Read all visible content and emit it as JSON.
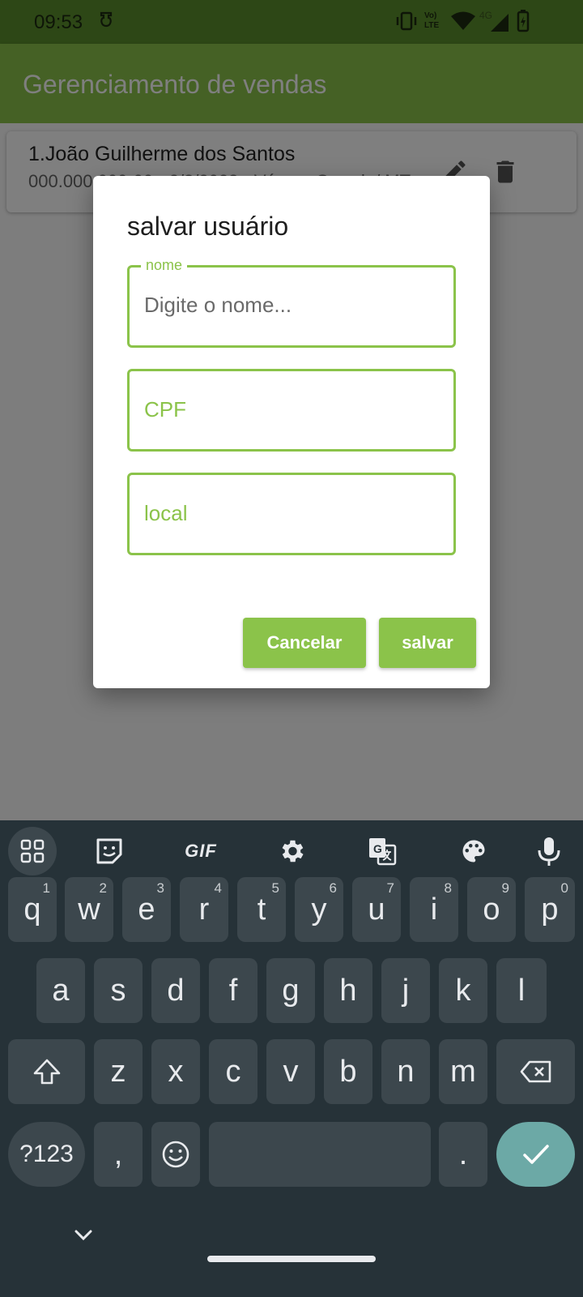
{
  "status_bar": {
    "time": "09:53",
    "network": "4G",
    "lte": "LTE"
  },
  "app_bar": {
    "title": "Gerenciamento de vendas"
  },
  "list": [
    {
      "title": "1.João Guilherme dos Santos",
      "subtitle": "000.000.000-00 - 2/3/2023 - Várzea Grande/ MT"
    }
  ],
  "dialog": {
    "title": "salvar usuário",
    "fields": [
      {
        "label": "nome",
        "placeholder": "Digite o nome..."
      },
      {
        "label": "CPF"
      },
      {
        "label": "local"
      }
    ],
    "cancel_label": "Cancelar",
    "save_label": "salvar"
  },
  "keyboard": {
    "toolbar_icons": [
      "apps-grid-icon",
      "sticker-icon",
      "gif-button",
      "settings-gear-icon",
      "translate-icon",
      "palette-icon",
      "microphone-icon"
    ],
    "gif_label": "GIF",
    "row1": [
      {
        "k": "q",
        "h": "1"
      },
      {
        "k": "w",
        "h": "2"
      },
      {
        "k": "e",
        "h": "3"
      },
      {
        "k": "r",
        "h": "4"
      },
      {
        "k": "t",
        "h": "5"
      },
      {
        "k": "y",
        "h": "6"
      },
      {
        "k": "u",
        "h": "7"
      },
      {
        "k": "i",
        "h": "8"
      },
      {
        "k": "o",
        "h": "9"
      },
      {
        "k": "p",
        "h": "0"
      }
    ],
    "row2": [
      "a",
      "s",
      "d",
      "f",
      "g",
      "h",
      "j",
      "k",
      "l"
    ],
    "row3": [
      "z",
      "x",
      "c",
      "v",
      "b",
      "n",
      "m"
    ],
    "symbols_label": "?123",
    "comma": ",",
    "period": "."
  },
  "colors": {
    "primary": "#8bc34a",
    "status_bar": "#5a8f2c",
    "keyboard_bg": "#263238",
    "key_bg": "#3c474d",
    "enter_key": "#6ca9a6"
  }
}
